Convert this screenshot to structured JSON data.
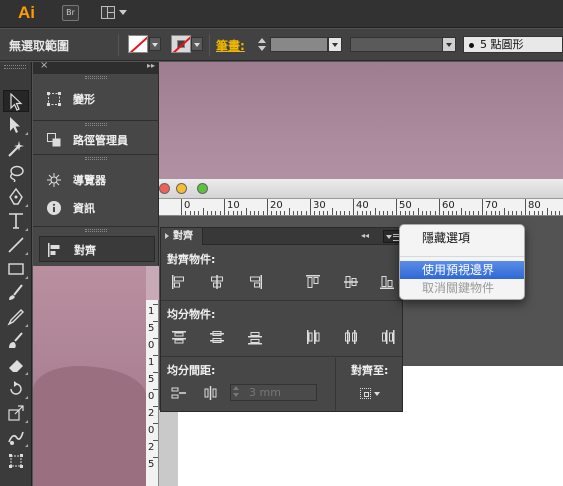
{
  "app": {
    "logo": "Ai",
    "bridge_label": "Br"
  },
  "control_bar": {
    "selection_label": "無選取範圍",
    "stroke_label": "筆畫:",
    "brush_label": "5 點圓形",
    "fill_color": "#ffffff",
    "none_color": "#e3141c"
  },
  "dock": {
    "items": [
      {
        "label": "變形",
        "icon": "transform-icon"
      },
      {
        "label": "路徑管理員",
        "icon": "pathfinder-icon"
      },
      {
        "label": "導覽器",
        "icon": "navigator-icon"
      },
      {
        "label": "資訊",
        "icon": "info-icon"
      },
      {
        "label": "對齊",
        "icon": "align-icon"
      }
    ]
  },
  "ruler": {
    "h_labels": [
      "0",
      "10",
      "20",
      "30",
      "40",
      "50",
      "60",
      "70",
      "80"
    ],
    "v_labels": [
      "1",
      "5",
      "0",
      "1",
      "5",
      "0",
      "2",
      "0",
      "2",
      "5"
    ]
  },
  "align_panel": {
    "tab_label": "對齊",
    "align_objects_label": "對齊物件:",
    "distribute_objects_label": "均分物件:",
    "distribute_spacing_label": "均分間距:",
    "align_to_label": "對齊至:",
    "spacing_value": "3 mm"
  },
  "popup_menu": {
    "items": [
      {
        "label": "隱藏選項",
        "state": "normal"
      },
      {
        "label": "使用預視邊界",
        "state": "highlighted"
      },
      {
        "label": "取消關鍵物件",
        "state": "disabled"
      }
    ]
  },
  "colors": {
    "accent_orange": "#ff9a00",
    "stroke_label_yellow": "#f0b800",
    "menu_highlight": "#2f67d6",
    "artwork_pink": "#ab8a9d"
  }
}
